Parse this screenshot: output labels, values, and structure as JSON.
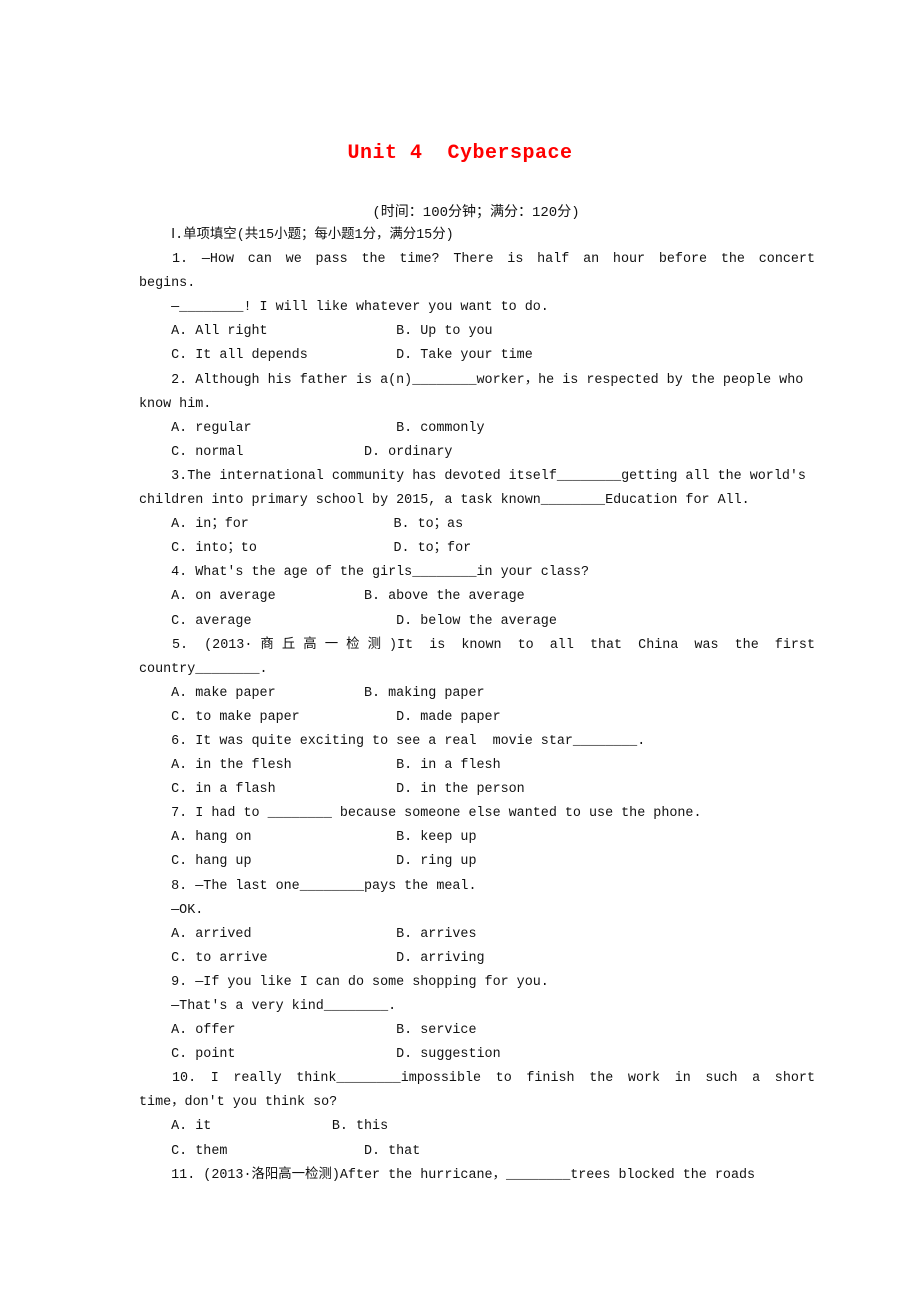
{
  "document": {
    "title": "Unit 4  Cyberspace",
    "subtitle": "(时间：100分钟；满分：120分)",
    "lines": [
      {
        "text": "    Ⅰ.单项填空(共15小题；每小题1分，满分15分)"
      },
      {
        "text": "    1. —How can we pass the time? There is half an hour before the concert",
        "justify": true
      },
      {
        "text": "begins."
      },
      {
        "text": "    —________! I will like whatever you want to do."
      },
      {
        "text": "    A. All right                B. Up to you"
      },
      {
        "text": "    C. It all depends           D. Take your time"
      },
      {
        "text": "    2. Although his father is a(n)________worker，he is respected by the people who"
      },
      {
        "text": "know him."
      },
      {
        "text": "    A. regular                  B. commonly"
      },
      {
        "text": "    C. normal               D. ordinary"
      },
      {
        "text": "    3.The international community has devoted itself________getting all the world's"
      },
      {
        "text": "children into primary school by 2015, a task known________Education for All."
      },
      {
        "text": "    A. in；for                  B. to；as"
      },
      {
        "text": "    C. into；to                 D. to；for"
      },
      {
        "text": "    4. What's the age of the girls________in your class?"
      },
      {
        "text": "    A. on average           B. above the average"
      },
      {
        "text": "    C. average                  D. below the average"
      },
      {
        "text": "    5. (2013·商丘高一检测)It is known to all that China was the first",
        "justify": true
      },
      {
        "text": "country________."
      },
      {
        "text": "    A. make paper           B. making paper"
      },
      {
        "text": "    C. to make paper            D. made paper"
      },
      {
        "text": "    6. It was quite exciting to see a real  movie star________."
      },
      {
        "text": "    A. in the flesh             B. in a flesh"
      },
      {
        "text": "    C. in a flash               D. in the person"
      },
      {
        "text": "    7. I had to ________ because someone else wanted to use the phone."
      },
      {
        "text": "    A. hang on                  B. keep up"
      },
      {
        "text": "    C. hang up                  D. ring up"
      },
      {
        "text": "    8. —The last one________pays the meal."
      },
      {
        "text": "    —OK."
      },
      {
        "text": "    A. arrived                  B. arrives"
      },
      {
        "text": "    C. to arrive                D. arriving"
      },
      {
        "text": "    9. —If you like I can do some shopping for you."
      },
      {
        "text": "    —That's a very kind________."
      },
      {
        "text": "    A. offer                    B. service"
      },
      {
        "text": "    C. point                    D. suggestion"
      },
      {
        "text": "    10. I really think________impossible to finish the work in such a short",
        "justify": true
      },
      {
        "text": "time，don't you think so?"
      },
      {
        "text": "    A. it               B. this"
      },
      {
        "text": "    C. them                 D. that"
      },
      {
        "text": "    11. (2013·洛阳高一检测)After the hurricane，________trees blocked the roads"
      }
    ]
  }
}
